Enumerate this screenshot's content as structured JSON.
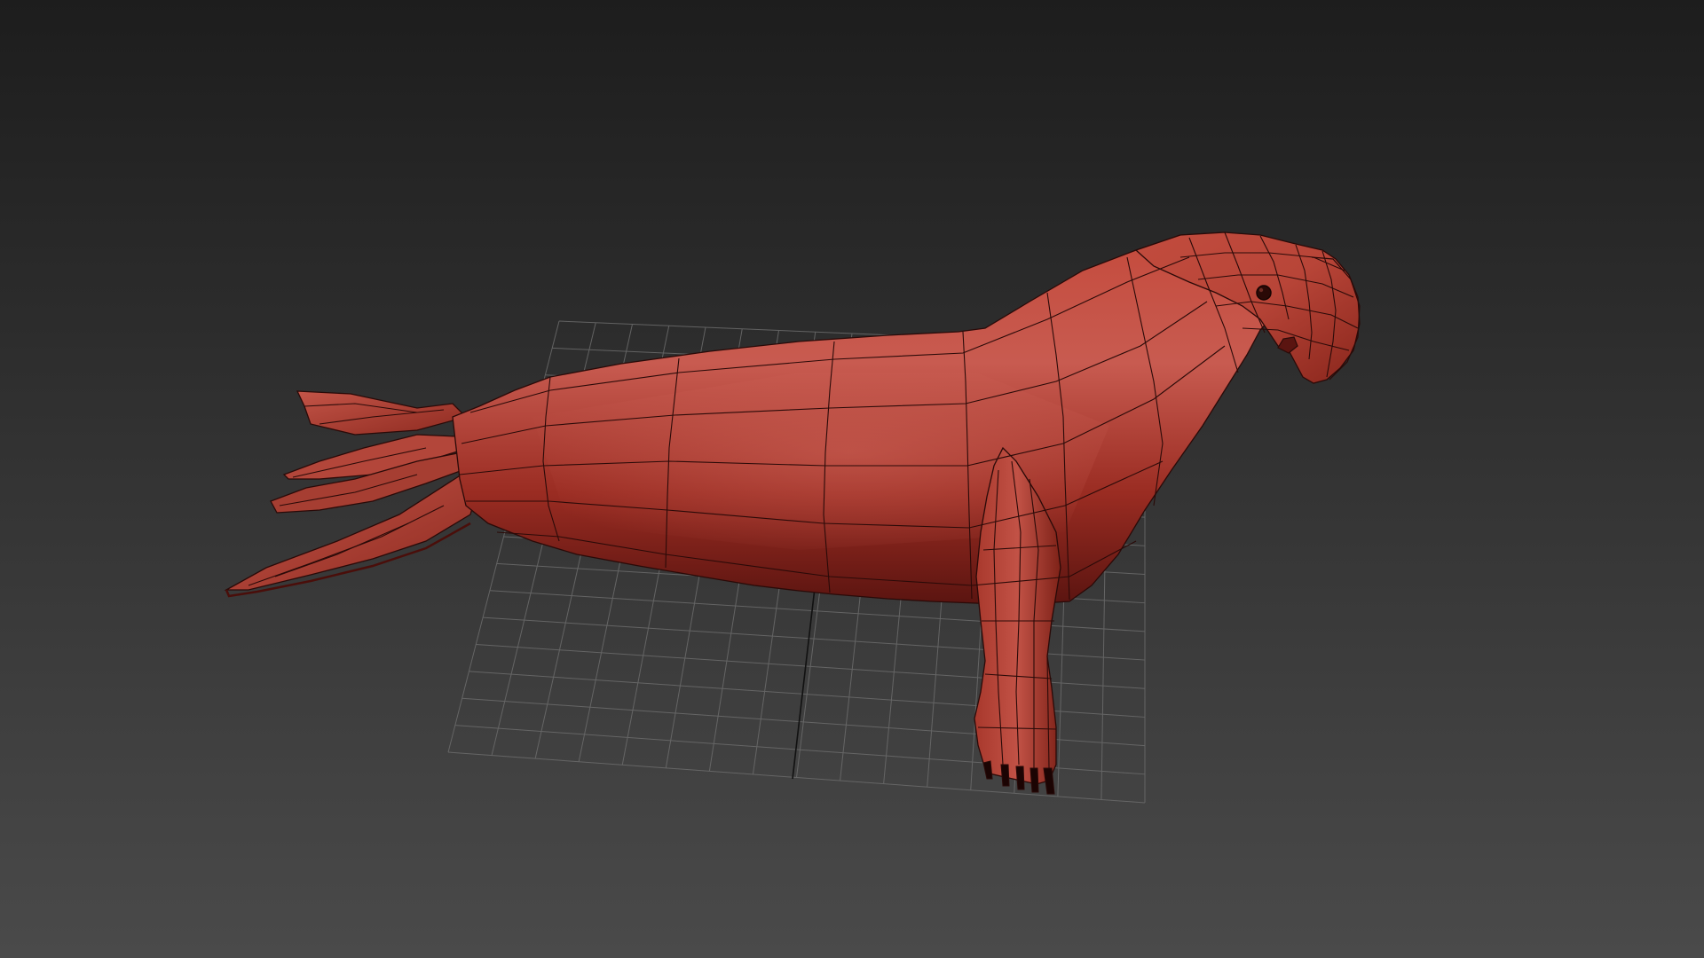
{
  "viewport": {
    "background_top_color": "#1e1e1e",
    "background_bottom_color": "#4a4a4a",
    "grid_color": "#707070",
    "grid_axis_color": "#101010",
    "grid_visible": true,
    "shading_mode": "smooth-shaded-with-wireframe-edges"
  },
  "model": {
    "object": "seal",
    "base_color": "#b04034",
    "highlight_color": "#c9584c",
    "shadow_color": "#5a1410",
    "wire_color": "#2a0a08"
  }
}
